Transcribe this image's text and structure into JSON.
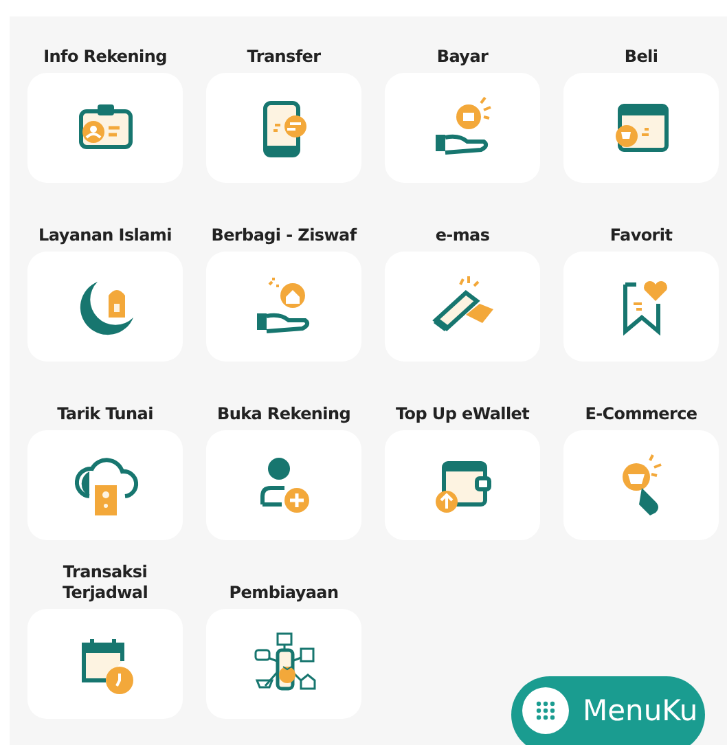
{
  "menu_items": [
    {
      "label": "Info Rekening"
    },
    {
      "label": "Transfer"
    },
    {
      "label": "Bayar"
    },
    {
      "label": "Beli"
    },
    {
      "label": "Layanan Islami"
    },
    {
      "label": "Berbagi - Ziswaf"
    },
    {
      "label": "e-mas"
    },
    {
      "label": "Favorit"
    },
    {
      "label": "Tarik Tunai"
    },
    {
      "label": "Buka Rekening"
    },
    {
      "label": "Top Up eWallet"
    },
    {
      "label": "E-Commerce"
    },
    {
      "label": "Transaksi\nTerjadwal"
    },
    {
      "label": "Pembiayaan"
    }
  ],
  "menuku_button": {
    "label": "MenuKu"
  }
}
